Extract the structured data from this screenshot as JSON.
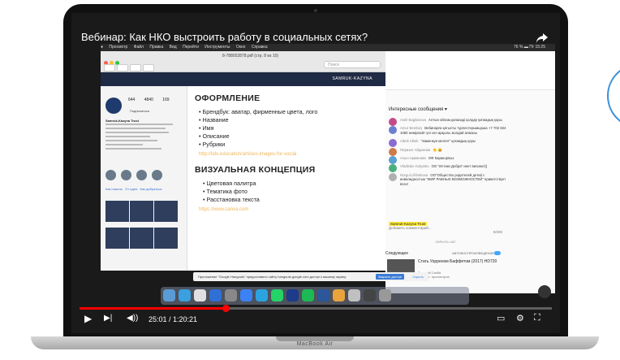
{
  "video": {
    "title": "Вебинар: Как НКО выстроить работу в социальных сетях?",
    "current_time": "25:01",
    "duration": "1:20:21",
    "time_display": "25:01 / 1:20:21",
    "progress_fraction": 0.31
  },
  "laptop": {
    "label": "MacBook Air"
  },
  "menubar": {
    "items": [
      "Просмотр",
      "Файл",
      "Правка",
      "Вид",
      "Перейти",
      "Инструменты",
      "Окно",
      "Справка"
    ],
    "status": "76 % ▬  Пт 15:25"
  },
  "preview": {
    "filename": "8-788052878.pdf (стр. 8 из 10)",
    "search_placeholder": "Поиск"
  },
  "slide": {
    "brand": "SAMRUK-KAZYNA",
    "section1_title": "ОФОРМЛЕНИЕ",
    "section1_items": [
      "Брендбук: аватар, фирменные цвета, лого",
      "Название",
      "Имя",
      "Описание",
      "Рубрики"
    ],
    "section1_link": "http://lido.education/articles-images-for-social",
    "section2_title": "ВИЗУАЛЬНАЯ КОНЦЕПЦИЯ",
    "section2_items": [
      "Цветовая палитра",
      "Тематика фото",
      "Расстановка текста"
    ],
    "section2_link": "https://www.canva.com"
  },
  "profile": {
    "stats": [
      "644",
      "4840",
      "169"
    ],
    "follow_label": "Подписаться",
    "name": "Samruk-Kazyna Trust",
    "links": [
      "Как помочь",
      "От идеи",
      "Как добраться"
    ]
  },
  "chat": {
    "header": "Интересные сообщения",
    "messages": [
      {
        "author": "Aseli Bagitanova",
        "text": "Алтын ойлам,қолжазді қолдау қоғамдық қоры",
        "color": "#c44a8a"
      },
      {
        "author": "Amur Berdsey",
        "text": "Вебинарға қатысты түрлестерымырша +7 702 824 1050 немірлайт үні сен арқылы жолдай алмасы",
        "color": "#6b7fd0"
      },
      {
        "author": "Aibek Aibek",
        "text": "\"Заменкүн мелгет\" қоғамдық қоры",
        "color": "#8c6bd0"
      },
      {
        "author": "Перизат Абдинова",
        "text": "👏 😀",
        "color": "#d07a4a"
      },
      {
        "author": "Асыл Арманова",
        "text": "ОФ Каракорпыз",
        "color": "#5aa0d0"
      },
      {
        "author": "Vladislav Golyarko",
        "text": "ОО \"Истоки Добра\" инет висинат))",
        "color": "#4ab07a"
      },
      {
        "author": "Nurgul Lifshekova",
        "text": "ОО\"Общество родителей детей с инвалидностью \"МИР РАВНЫХ ВОЗМОЖНОСТЕЙ\" приветствует всех!",
        "color": "#b0b0b0"
      }
    ],
    "input_author": "Samruk-Kazyna Trust",
    "input_placeholder": "Добавить комментарий...",
    "char_count": "0/200",
    "hide_chat": "СКРЫТЬ ЧАТ"
  },
  "up_next": {
    "header": "Следующее",
    "autoplay_label": "АВТОВОСПРОИЗВЕДЕНИЕ",
    "video_title": "Стать Уорреном Баффетом (2017) HD720",
    "channel": "Виталий Скиба",
    "views": "520 тыс. просмотров"
  },
  "notification": {
    "text": "Приложение \"Google Hangouts\" предоставило сайту hangouts.google.com доступ к вашему экрану.",
    "stop_label": "Закрыть доступ",
    "hide_label": "Скрыть"
  },
  "colors": {
    "accent_red": "#ff0000",
    "slide_link": "#f0b65a",
    "slide_header": "#1f2a44"
  }
}
